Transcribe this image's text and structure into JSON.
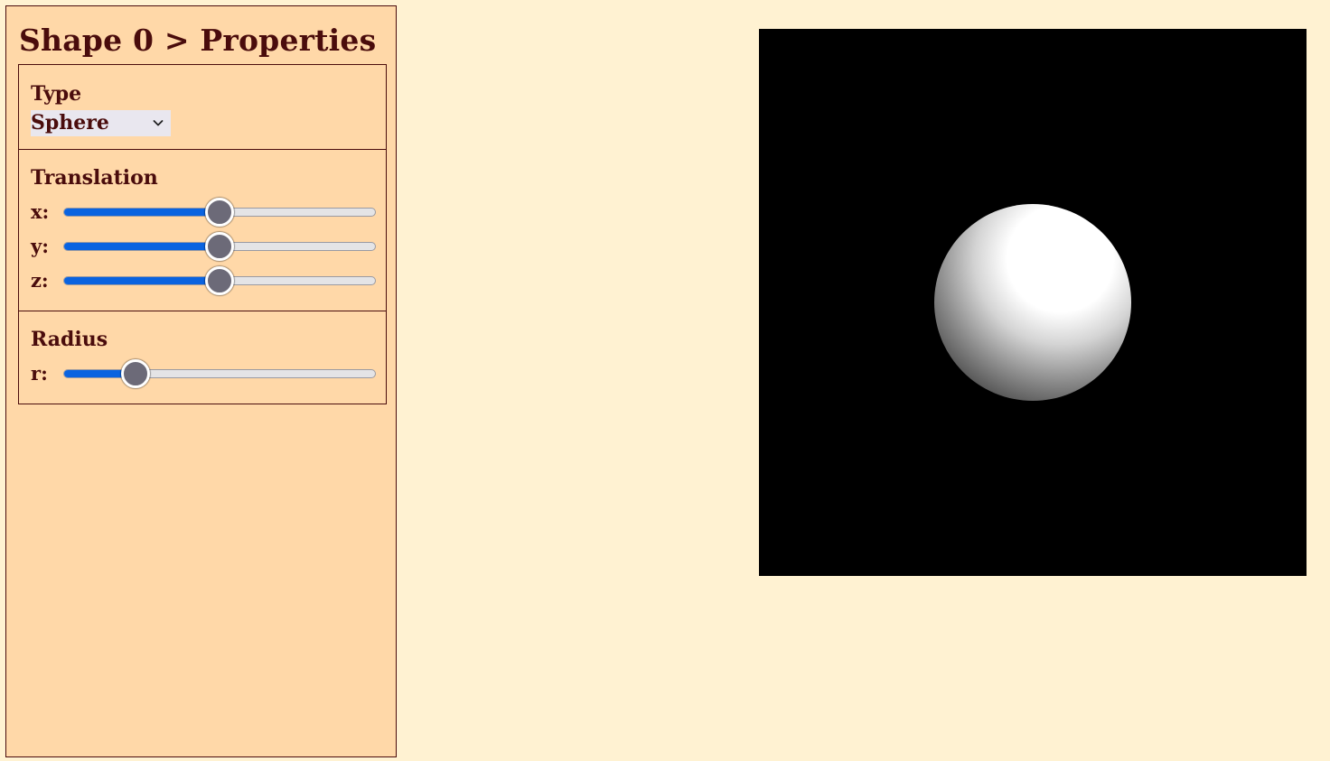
{
  "panel": {
    "title": "Shape 0 > Properties",
    "background": "#ffd8a8",
    "text_color": "#4a0c0c"
  },
  "type_section": {
    "heading": "Type",
    "select_value": "Sphere",
    "select_icon": "chevron-down-icon"
  },
  "translation_section": {
    "heading": "Translation",
    "sliders": [
      {
        "label": "x:",
        "value": 0.5
      },
      {
        "label": "y:",
        "value": 0.5
      },
      {
        "label": "z:",
        "value": 0.5
      }
    ]
  },
  "radius_section": {
    "heading": "Radius",
    "sliders": [
      {
        "label": "r:",
        "value": 0.23
      }
    ]
  },
  "viewport": {
    "background": "#000000",
    "object": "sphere",
    "object_color": "#ffffff"
  },
  "colors": {
    "page_background": "#fff2d2",
    "slider_fill": "#0a63e0",
    "slider_thumb": "#6c6a78"
  }
}
